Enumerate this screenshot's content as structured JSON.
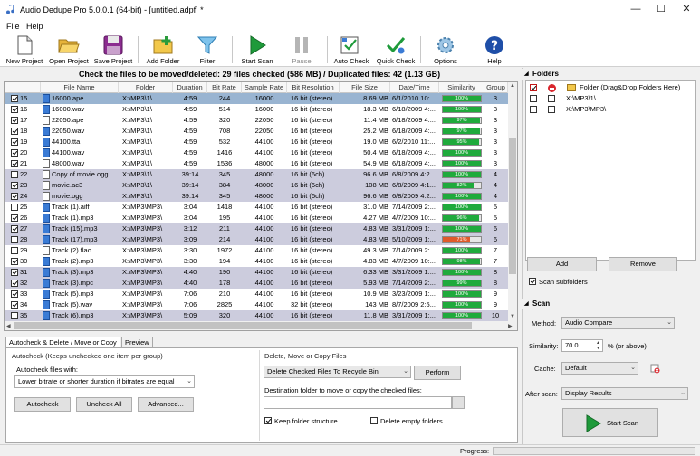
{
  "window": {
    "title": "Audio Dedupe Pro 5.0.0.1 (64-bit) - [untitled.adpf] *",
    "minimize": "—",
    "maximize": "☐",
    "close": "✕"
  },
  "menu": [
    "File",
    "Help"
  ],
  "toolbar": [
    {
      "label": "New Project",
      "icon": "new-project-icon",
      "enabled": true
    },
    {
      "label": "Open Project",
      "icon": "open-folder-icon",
      "enabled": true
    },
    {
      "label": "Save Project",
      "icon": "save-disk-icon",
      "enabled": true
    },
    {
      "label": "Add Folder",
      "icon": "add-folder-icon",
      "enabled": true
    },
    {
      "label": "Filter",
      "icon": "funnel-icon",
      "enabled": true
    },
    {
      "label": "Start Scan",
      "icon": "play-icon",
      "enabled": true
    },
    {
      "label": "Pause",
      "icon": "pause-icon",
      "enabled": false
    },
    {
      "label": "Auto Check",
      "icon": "auto-check-icon",
      "enabled": true
    },
    {
      "label": "Quick Check",
      "icon": "quick-check-icon",
      "enabled": true
    },
    {
      "label": "Options",
      "icon": "gear-icon",
      "enabled": true
    },
    {
      "label": "Help",
      "icon": "help-icon",
      "enabled": true
    }
  ],
  "summary": "Check the files to be moved/deleted: 29 files checked (586 MB) / Duplicated files: 42 (1.13 GB)",
  "columns": [
    "File Name",
    "Folder",
    "Duration",
    "Bit Rate",
    "Sample Rate",
    "Bit Resolution",
    "File Size",
    "Date/Time",
    "Similarity",
    "Group"
  ],
  "rows": [
    {
      "checked": true,
      "num": "15",
      "icon": "note",
      "name": "16000.ape",
      "folder": "X:\\MP3\\1\\",
      "duration": "4:59",
      "bitrate": "244",
      "sample": "16000",
      "res": "16 bit (stereo)",
      "size": "8.69 MB",
      "date": "6/1/2010 10:...",
      "sim": 100,
      "simtxt": "100%",
      "group": "3",
      "style": "sel"
    },
    {
      "checked": true,
      "num": "16",
      "icon": "note",
      "name": "16000.wav",
      "folder": "X:\\MP3\\1\\",
      "duration": "4:59",
      "bitrate": "514",
      "sample": "16000",
      "res": "16 bit (stereo)",
      "size": "18.3 MB",
      "date": "6/18/2009 4:...",
      "sim": 100,
      "simtxt": "100%",
      "group": "3",
      "style": "even"
    },
    {
      "checked": true,
      "num": "17",
      "icon": "doc",
      "name": "22050.ape",
      "folder": "X:\\MP3\\1\\",
      "duration": "4:59",
      "bitrate": "320",
      "sample": "22050",
      "res": "16 bit (stereo)",
      "size": "11.4 MB",
      "date": "6/18/2009 4:...",
      "sim": 97,
      "simtxt": "97%",
      "group": "3",
      "style": "even"
    },
    {
      "checked": true,
      "num": "18",
      "icon": "note",
      "name": "22050.wav",
      "folder": "X:\\MP3\\1\\",
      "duration": "4:59",
      "bitrate": "708",
      "sample": "22050",
      "res": "16 bit (stereo)",
      "size": "25.2 MB",
      "date": "6/18/2009 4:...",
      "sim": 97,
      "simtxt": "97%",
      "group": "3",
      "style": "even"
    },
    {
      "checked": true,
      "num": "19",
      "icon": "note",
      "name": "44100.tta",
      "folder": "X:\\MP3\\1\\",
      "duration": "4:59",
      "bitrate": "532",
      "sample": "44100",
      "res": "16 bit (stereo)",
      "size": "19.0 MB",
      "date": "6/2/2010 11:...",
      "sim": 95,
      "simtxt": "95%",
      "group": "3",
      "style": "even"
    },
    {
      "checked": true,
      "num": "20",
      "icon": "note",
      "name": "44100.wav",
      "folder": "X:\\MP3\\1\\",
      "duration": "4:59",
      "bitrate": "1416",
      "sample": "44100",
      "res": "16 bit (stereo)",
      "size": "50.4 MB",
      "date": "6/18/2009 4:...",
      "sim": 100,
      "simtxt": "100%",
      "group": "3",
      "style": "even"
    },
    {
      "checked": true,
      "num": "21",
      "icon": "doc",
      "name": "48000.wav",
      "folder": "X:\\MP3\\1\\",
      "duration": "4:59",
      "bitrate": "1536",
      "sample": "48000",
      "res": "16 bit (stereo)",
      "size": "54.9 MB",
      "date": "6/18/2009 4:...",
      "sim": 100,
      "simtxt": "100%",
      "group": "3",
      "style": "even"
    },
    {
      "checked": false,
      "num": "22",
      "icon": "doc",
      "name": "Copy of movie.ogg",
      "folder": "X:\\MP3\\1\\",
      "duration": "39:14",
      "bitrate": "345",
      "sample": "48000",
      "res": "16 bit (6ch)",
      "size": "96.6 MB",
      "date": "6/8/2009 4:2...",
      "sim": 100,
      "simtxt": "100%",
      "group": "4",
      "style": "odd"
    },
    {
      "checked": true,
      "num": "23",
      "icon": "doc",
      "name": "movie.ac3",
      "folder": "X:\\MP3\\1\\",
      "duration": "39:14",
      "bitrate": "384",
      "sample": "48000",
      "res": "16 bit (6ch)",
      "size": "108 MB",
      "date": "6/8/2009 4:1...",
      "sim": 82,
      "simtxt": "82%",
      "group": "4",
      "style": "odd"
    },
    {
      "checked": true,
      "num": "24",
      "icon": "doc",
      "name": "movie.ogg",
      "folder": "X:\\MP3\\1\\",
      "duration": "39:14",
      "bitrate": "345",
      "sample": "48000",
      "res": "16 bit (6ch)",
      "size": "96.6 MB",
      "date": "6/8/2009 4:2...",
      "sim": 100,
      "simtxt": "100%",
      "group": "4",
      "style": "odd"
    },
    {
      "checked": false,
      "num": "25",
      "icon": "note",
      "name": "Track (1).aiff",
      "folder": "X:\\MP3\\MP3\\",
      "duration": "3:04",
      "bitrate": "1418",
      "sample": "44100",
      "res": "16 bit (stereo)",
      "size": "31.0 MB",
      "date": "7/14/2009 2:...",
      "sim": 100,
      "simtxt": "100%",
      "group": "5",
      "style": "even"
    },
    {
      "checked": true,
      "num": "26",
      "icon": "note",
      "name": "Track (1).mp3",
      "folder": "X:\\MP3\\MP3\\",
      "duration": "3:04",
      "bitrate": "195",
      "sample": "44100",
      "res": "16 bit (stereo)",
      "size": "4.27 MB",
      "date": "4/7/2009 10:...",
      "sim": 96,
      "simtxt": "96%",
      "group": "5",
      "style": "even"
    },
    {
      "checked": true,
      "num": "27",
      "icon": "note",
      "name": "Track (15).mp3",
      "folder": "X:\\MP3\\MP3\\",
      "duration": "3:12",
      "bitrate": "211",
      "sample": "44100",
      "res": "16 bit (stereo)",
      "size": "4.83 MB",
      "date": "3/31/2009 1:...",
      "sim": 100,
      "simtxt": "100%",
      "group": "6",
      "style": "odd"
    },
    {
      "checked": false,
      "num": "28",
      "icon": "note",
      "name": "Track (17).mp3",
      "folder": "X:\\MP3\\MP3\\",
      "duration": "3:09",
      "bitrate": "214",
      "sample": "44100",
      "res": "16 bit (stereo)",
      "size": "4.83 MB",
      "date": "5/10/2009 1:...",
      "sim": 71,
      "simtxt": "71%",
      "group": "6",
      "style": "odd",
      "red": true
    },
    {
      "checked": false,
      "num": "29",
      "icon": "doc",
      "name": "Track (2).flac",
      "folder": "X:\\MP3\\MP3\\",
      "duration": "3:30",
      "bitrate": "1972",
      "sample": "44100",
      "res": "16 bit (stereo)",
      "size": "49.3 MB",
      "date": "7/14/2009 2:...",
      "sim": 100,
      "simtxt": "100%",
      "group": "7",
      "style": "even"
    },
    {
      "checked": true,
      "num": "30",
      "icon": "note",
      "name": "Track (2).mp3",
      "folder": "X:\\MP3\\MP3\\",
      "duration": "3:30",
      "bitrate": "194",
      "sample": "44100",
      "res": "16 bit (stereo)",
      "size": "4.83 MB",
      "date": "4/7/2009 10:...",
      "sim": 98,
      "simtxt": "98%",
      "group": "7",
      "style": "even"
    },
    {
      "checked": true,
      "num": "31",
      "icon": "note",
      "name": "Track (3).mp3",
      "folder": "X:\\MP3\\MP3\\",
      "duration": "4:40",
      "bitrate": "190",
      "sample": "44100",
      "res": "16 bit (stereo)",
      "size": "6.33 MB",
      "date": "3/31/2009 1:...",
      "sim": 100,
      "simtxt": "100%",
      "group": "8",
      "style": "odd"
    },
    {
      "checked": true,
      "num": "32",
      "icon": "note",
      "name": "Track (3).mpc",
      "folder": "X:\\MP3\\MP3\\",
      "duration": "4:40",
      "bitrate": "178",
      "sample": "44100",
      "res": "16 bit (stereo)",
      "size": "5.93 MB",
      "date": "7/14/2009 2:...",
      "sim": 99,
      "simtxt": "99%",
      "group": "8",
      "style": "odd"
    },
    {
      "checked": true,
      "num": "33",
      "icon": "note",
      "name": "Track (5).mp3",
      "folder": "X:\\MP3\\MP3\\",
      "duration": "7:06",
      "bitrate": "210",
      "sample": "44100",
      "res": "16 bit (stereo)",
      "size": "10.9 MB",
      "date": "3/23/2009 1:...",
      "sim": 100,
      "simtxt": "100%",
      "group": "9",
      "style": "even"
    },
    {
      "checked": true,
      "num": "34",
      "icon": "note",
      "name": "Track (5).wav",
      "folder": "X:\\MP3\\MP3\\",
      "duration": "7:06",
      "bitrate": "2825",
      "sample": "44100",
      "res": "32 bit (stereo)",
      "size": "143 MB",
      "date": "8/7/2009 2:5...",
      "sim": 100,
      "simtxt": "100%",
      "group": "9",
      "style": "even"
    },
    {
      "checked": false,
      "num": "35",
      "icon": "note",
      "name": "Track (6).mp3",
      "folder": "X:\\MP3\\MP3\\",
      "duration": "5:09",
      "bitrate": "320",
      "sample": "44100",
      "res": "16 bit (stereo)",
      "size": "11.8 MB",
      "date": "3/31/2009 1:...",
      "sim": 100,
      "simtxt": "100%",
      "group": "10",
      "style": "odd"
    },
    {
      "checked": true,
      "num": "36",
      "icon": "note",
      "name": "Track (6).wv",
      "folder": "X:\\MP3\\MP3\\",
      "duration": "5:09",
      "bitrate": "1946",
      "sample": "44100",
      "res": "32 bit (stereo)",
      "size": "71.6 MB",
      "date": "7/14/2009 2:...",
      "sim": 81,
      "simtxt": "81%",
      "group": "10",
      "style": "odd"
    }
  ],
  "tabs": [
    "Autocheck & Delete / Move or Copy",
    "Preview"
  ],
  "autocheck": {
    "group_label": "Autocheck (Keeps unchecked one item per group)",
    "files_with_label": "Autocheck files with:",
    "files_with_value": "Lower bitrate or shorter duration if bitrates are equal",
    "autocheck_btn": "Autocheck",
    "uncheck_all_btn": "Uncheck All",
    "advanced_btn": "Advanced..."
  },
  "delete": {
    "group_label": "Delete, Move or Copy Files",
    "action_value": "Delete Checked Files To Recycle Bin",
    "perform_btn": "Perform",
    "dest_label": "Destination folder to move or copy the checked files:",
    "dest_value": "",
    "browse_btn": "...",
    "keep_structure_label": "Keep folder structure",
    "keep_structure_checked": true,
    "delete_empty_label": "Delete empty folders",
    "delete_empty_checked": false
  },
  "status": {
    "progress_label": "Progress:"
  },
  "folders_panel": {
    "title": "Folders",
    "dropzone": "Folder (Drag&Drop Folders Here)",
    "items": [
      "X:\\MP3\\1\\",
      "X:\\MP3\\MP3\\"
    ],
    "add_btn": "Add",
    "remove_btn": "Remove",
    "scan_subfolders_label": "Scan subfolders",
    "scan_subfolders_checked": true
  },
  "scan_panel": {
    "title": "Scan",
    "method_label": "Method:",
    "method_value": "Audio Compare",
    "similarity_label": "Similarity:",
    "similarity_value": "70.0",
    "similarity_suffix": "% (or above)",
    "cache_label": "Cache:",
    "cache_value": "Default",
    "after_scan_label": "After scan:",
    "after_scan_value": "Display Results",
    "start_btn": "Start Scan"
  },
  "colors": {
    "accent_green": "#1faa3c",
    "row_alt": "#ccccdd",
    "row_selected": "#99b4d1",
    "similarity_low": "#e05a2a"
  }
}
